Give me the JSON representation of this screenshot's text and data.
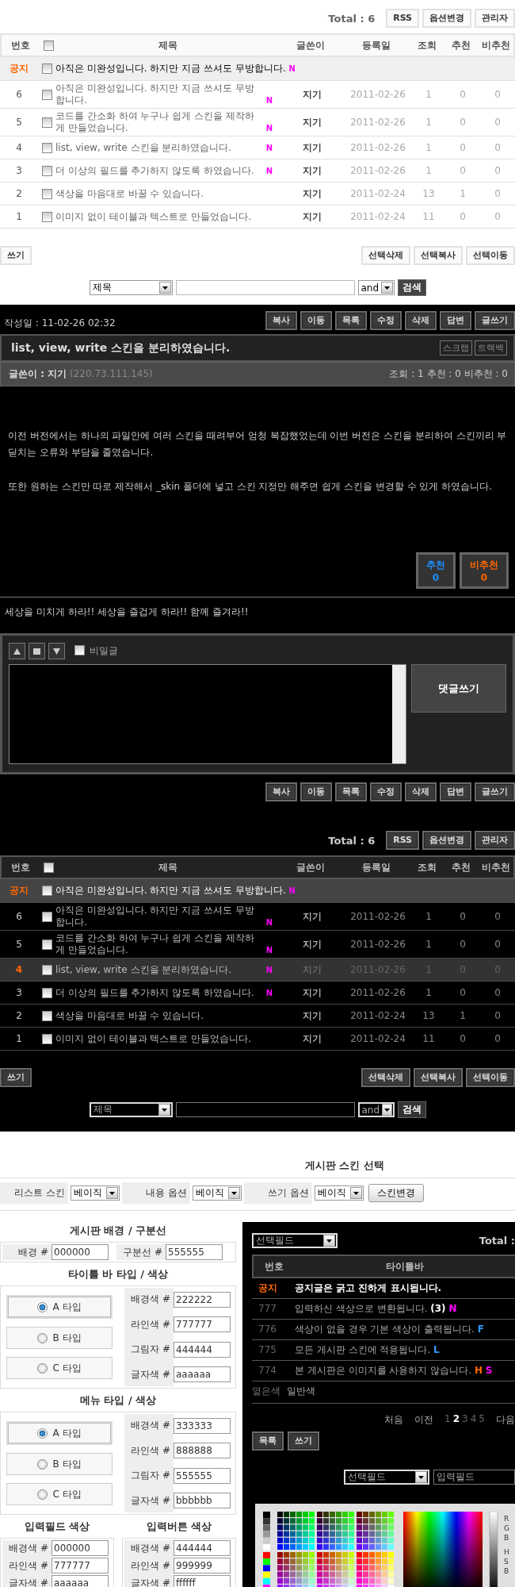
{
  "list_top": {
    "dark": false,
    "total": "Total : 6",
    "top_buttons": [
      "RSS",
      "옵션변경",
      "관리자"
    ],
    "columns": [
      "번호",
      "제목",
      "글쓴이",
      "등록일",
      "조회",
      "추천",
      "비추천"
    ],
    "select_all_checked": false,
    "rows": [
      {
        "number": "공지",
        "kind": "notice",
        "title": "아직은 미완성입니다. 하지만 지금 쓰셔도 무방합니다.",
        "badge": "N",
        "checked": false,
        "selected": false
      },
      {
        "number": "6",
        "kind": "post",
        "title": "아직은 미완성입니다. 하지만 지금 쓰셔도 무방합니다.",
        "badge": "N",
        "author": "지기",
        "date": "2011-02-26",
        "views": "1",
        "up": "0",
        "down": "0",
        "checked": false,
        "selected": false
      },
      {
        "number": "5",
        "kind": "post",
        "title": "코드를 간소화 하여 누구나 쉽게 스킨을 제작하게 만들었습니다.",
        "badge": "N",
        "author": "지기",
        "date": "2011-02-26",
        "views": "1",
        "up": "0",
        "down": "0",
        "checked": false,
        "selected": false
      },
      {
        "number": "4",
        "kind": "post",
        "title": "list, view, write 스킨을 분리하였습니다.",
        "badge": "N",
        "author": "지기",
        "date": "2011-02-26",
        "views": "1",
        "up": "0",
        "down": "0",
        "checked": false,
        "selected": false
      },
      {
        "number": "3",
        "kind": "post",
        "title": "더 이상의 필드를 추가하지 않도록 하였습니다.",
        "badge": "N",
        "author": "지기",
        "date": "2011-02-26",
        "views": "1",
        "up": "0",
        "down": "0",
        "checked": false,
        "selected": false
      },
      {
        "number": "2",
        "kind": "post",
        "title": "색상을 마음대로 바꿀 수 있습니다.",
        "author": "지기",
        "date": "2011-02-24",
        "views": "13",
        "up": "1",
        "down": "0",
        "checked": false,
        "selected": false
      },
      {
        "number": "1",
        "kind": "post",
        "title": "이미지 없이 테이블과 텍스트로 만들었습니다.",
        "author": "지기",
        "date": "2011-02-24",
        "views": "11",
        "up": "0",
        "down": "0",
        "checked": false,
        "selected": false
      }
    ],
    "left_buttons": [
      "쓰기"
    ],
    "right_buttons": [
      "선택삭제",
      "선택복사",
      "선택이동"
    ],
    "search": {
      "field": "제목",
      "operator": "and",
      "button": "검색"
    }
  },
  "view": {
    "date": "작성일 : 11-02-26 02:32",
    "buttons": [
      "복사",
      "이동",
      "목록",
      "수정",
      "삭제",
      "답변",
      "글쓰기"
    ],
    "title": "list, view, write 스킨을 분리하였습니다.",
    "title_buttons": [
      "스크랩",
      "트랙백"
    ],
    "author": "글쓴이 : 지기",
    "ip": "(220.73.111.145)",
    "stats": "조회 : 1 추천 : 0 비추천 : 0",
    "paragraphs": [
      "이전 버전에서는 하나의 파일안에 여러 스킨을 때려부어 엄청 복잡했었는데 이번 버전은 스킨을 분리하여 스킨끼리 부딛치는 오류와 부담을 줄였습니다.",
      "또한 원하는 스킨만 따로 제작해서 _skin 폴더에 넣고 스킨 지정만 해주면 쉽게 스킨을 변경할 수 있게 하였습니다."
    ],
    "votes": [
      {
        "label": "추천",
        "count": "0",
        "color": "#1e90ff"
      },
      {
        "label": "비추천",
        "count": "0",
        "color": "#ff6600"
      }
    ],
    "comments": [
      "세상을 미치게 하라!! 세상을 즐겁게 하라!! 함께 즐겨라!!"
    ],
    "comment_form": {
      "secret_label": "비밀글",
      "secret_checked": false,
      "submit": "댓글쓰기"
    },
    "bottom_buttons": [
      "복사",
      "이동",
      "목록",
      "수정",
      "삭제",
      "답변",
      "글쓰기"
    ]
  },
  "list_bottom": {
    "dark": true,
    "total": "Total : 6",
    "top_buttons": [
      "RSS",
      "옵션변경",
      "관리자"
    ],
    "columns": [
      "번호",
      "제목",
      "글쓴이",
      "등록일",
      "조회",
      "추천",
      "비추천"
    ],
    "select_all_checked": false,
    "rows": [
      {
        "number": "공지",
        "kind": "notice",
        "title": "아직은 미완성입니다. 하지만 지금 쓰셔도 무방합니다.",
        "badge": "N",
        "checked": false,
        "selected": false
      },
      {
        "number": "6",
        "kind": "post",
        "title": "아직은 미완성입니다. 하지만 지금 쓰셔도 무방합니다.",
        "badge": "N",
        "author": "지기",
        "date": "2011-02-26",
        "views": "1",
        "up": "0",
        "down": "0",
        "checked": false,
        "selected": false
      },
      {
        "number": "5",
        "kind": "post",
        "title": "코드를 간소화 하여 누구나 쉽게 스킨을 제작하게 만들었습니다.",
        "badge": "N",
        "author": "지기",
        "date": "2011-02-26",
        "views": "1",
        "up": "0",
        "down": "0",
        "checked": false,
        "selected": false
      },
      {
        "number": "4",
        "kind": "post",
        "title": "list, view, write 스킨을 분리하였습니다.",
        "badge": "N",
        "author": "지기",
        "date": "2011-02-26",
        "views": "1",
        "up": "0",
        "down": "0",
        "checked": false,
        "selected": true
      },
      {
        "number": "3",
        "kind": "post",
        "title": "더 이상의 필드를 추가하지 않도록 하였습니다.",
        "badge": "N",
        "author": "지기",
        "date": "2011-02-26",
        "views": "1",
        "up": "0",
        "down": "0",
        "checked": false,
        "selected": false
      },
      {
        "number": "2",
        "kind": "post",
        "title": "색상을 마음대로 바꿀 수 있습니다.",
        "author": "지기",
        "date": "2011-02-24",
        "views": "13",
        "up": "1",
        "down": "0",
        "checked": false,
        "selected": false
      },
      {
        "number": "1",
        "kind": "post",
        "title": "이미지 없이 테이블과 텍스트로 만들었습니다.",
        "author": "지기",
        "date": "2011-02-24",
        "views": "11",
        "up": "0",
        "down": "0",
        "checked": false,
        "selected": false
      }
    ],
    "left_buttons": [
      "쓰기"
    ],
    "right_buttons": [
      "선택삭제",
      "선택복사",
      "선택이동"
    ],
    "search": {
      "field": "제목",
      "operator": "and",
      "button": "검색"
    }
  },
  "settings": {
    "title": "게시판 스킨 선택",
    "skins": [
      {
        "label": "리스트 스킨",
        "value": "베이직"
      },
      {
        "label": "내용 옵션",
        "value": "베이직"
      },
      {
        "label": "쓰기 옵션",
        "value": "베이직"
      }
    ],
    "change_button": "스킨변경",
    "background": {
      "heading": "게시판 배경 / 구분선",
      "fields": [
        {
          "label": "배경 #",
          "value": "000000"
        },
        {
          "label": "구분선 #",
          "value": "555555"
        }
      ]
    },
    "title_bar": {
      "heading": "타이틀 바 타입 / 색상",
      "types": [
        {
          "label": "A 타입",
          "selected": true
        },
        {
          "label": "B 타입",
          "selected": false
        },
        {
          "label": "C 타입",
          "selected": false
        }
      ],
      "fields": [
        {
          "label": "배경색 #",
          "value": "222222"
        },
        {
          "label": "라인색 #",
          "value": "777777"
        },
        {
          "label": "그림자 #",
          "value": "444444"
        },
        {
          "label": "글자색 #",
          "value": "aaaaaa"
        }
      ]
    },
    "menu": {
      "heading": "메뉴 타입 / 색상",
      "types": [
        {
          "label": "A 타입",
          "selected": true
        },
        {
          "label": "B 타입",
          "selected": false
        },
        {
          "label": "C 타입",
          "selected": false
        }
      ],
      "fields": [
        {
          "label": "배경색 #",
          "value": "333333"
        },
        {
          "label": "라인색 #",
          "value": "888888"
        },
        {
          "label": "그림자 #",
          "value": "555555"
        },
        {
          "label": "글자색 #",
          "value": "bbbbbb"
        }
      ]
    },
    "input_colors": {
      "heading": "입력필드 색상",
      "fields": [
        {
          "label": "배경색 #",
          "value": "000000"
        },
        {
          "label": "라인색 #",
          "value": "777777"
        },
        {
          "label": "글자색 #",
          "value": "aaaaaa"
        }
      ]
    },
    "button_colors": {
      "heading": "입력버튼 색상",
      "fields": [
        {
          "label": "배경색 #",
          "value": "444444"
        },
        {
          "label": "라인색 #",
          "value": "999999"
        },
        {
          "label": "글자색 #",
          "value": "ffffff"
        }
      ]
    },
    "preview": {
      "select": "선택필드",
      "total": "Total :",
      "columns": [
        "번호",
        "타이틀바"
      ],
      "rows": [
        {
          "number": "공지",
          "kind": "notice",
          "text": "공지글은 굵고 진하게 표시됩니다."
        },
        {
          "number": "777",
          "kind": "post",
          "text": "입력하신 색상으로 변환됩니다.",
          "tags": [
            {
              "text": "(3)",
              "color": "#ffffff"
            },
            {
              "text": "N",
              "color": "#ff00ff"
            }
          ]
        },
        {
          "number": "776",
          "kind": "post",
          "text": "색상이 없을 경우 기본 색상이 출력됩니다.",
          "tags": [
            {
              "text": "F",
              "color": "#3399ff"
            }
          ]
        },
        {
          "number": "775",
          "kind": "post",
          "text": "모든 게시판 스킨에 적용됩니다.",
          "tags": [
            {
              "text": "L",
              "color": "#3399ff"
            }
          ]
        },
        {
          "number": "774",
          "kind": "post",
          "text": "본 게시판은 이미지를 사용하지 않습니다.",
          "tags": [
            {
              "text": "H",
              "color": "#ff6600"
            },
            {
              "text": "S",
              "color": "#ff00ff"
            }
          ]
        }
      ],
      "legend": [
        {
          "label": "옅은색",
          "color": "#777777"
        },
        {
          "label": "일반색",
          "color": "#aaaaaa"
        }
      ],
      "pagination": {
        "first": "처음",
        "prev": "이전",
        "pages": [
          {
            "label": "1",
            "selected": false
          },
          {
            "label": "2",
            "selected": true
          },
          {
            "label": "3",
            "selected": false
          },
          {
            "label": "4",
            "selected": false
          },
          {
            "label": "5",
            "selected": false
          }
        ],
        "next": "다음"
      },
      "buttons": [
        "목록",
        "쓰기"
      ],
      "search_select": "선택필드",
      "search_input": "입력필드",
      "picker_labels": [
        "R",
        "G",
        "B",
        "H",
        "S",
        "B"
      ]
    }
  }
}
